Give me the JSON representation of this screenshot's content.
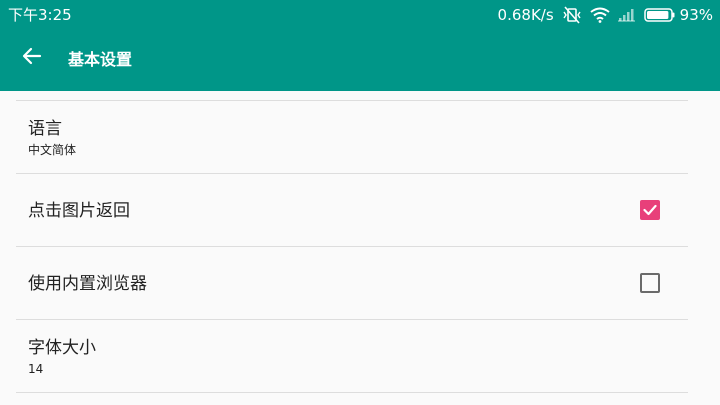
{
  "status_bar": {
    "time": "下午3:25",
    "network_speed": "0.68K/s",
    "battery_percent": "93%",
    "battery_level": 0.93,
    "icons": [
      "vibrate-off-icon",
      "wifi-icon",
      "signal-icon",
      "battery-icon"
    ]
  },
  "toolbar": {
    "back_icon": "arrow-left-icon",
    "title": "基本设置"
  },
  "settings": [
    {
      "title": "语言",
      "subtitle": "中文简体"
    },
    {
      "title": "点击图片返回",
      "checked": true
    },
    {
      "title": "使用内置浏览器",
      "checked": false
    },
    {
      "title": "字体大小",
      "subtitle": "14"
    }
  ],
  "colors": {
    "primary": "#009688",
    "accent": "#e8407a",
    "background": "#fafafa",
    "divider": "#dddddd",
    "text": "#222222"
  }
}
